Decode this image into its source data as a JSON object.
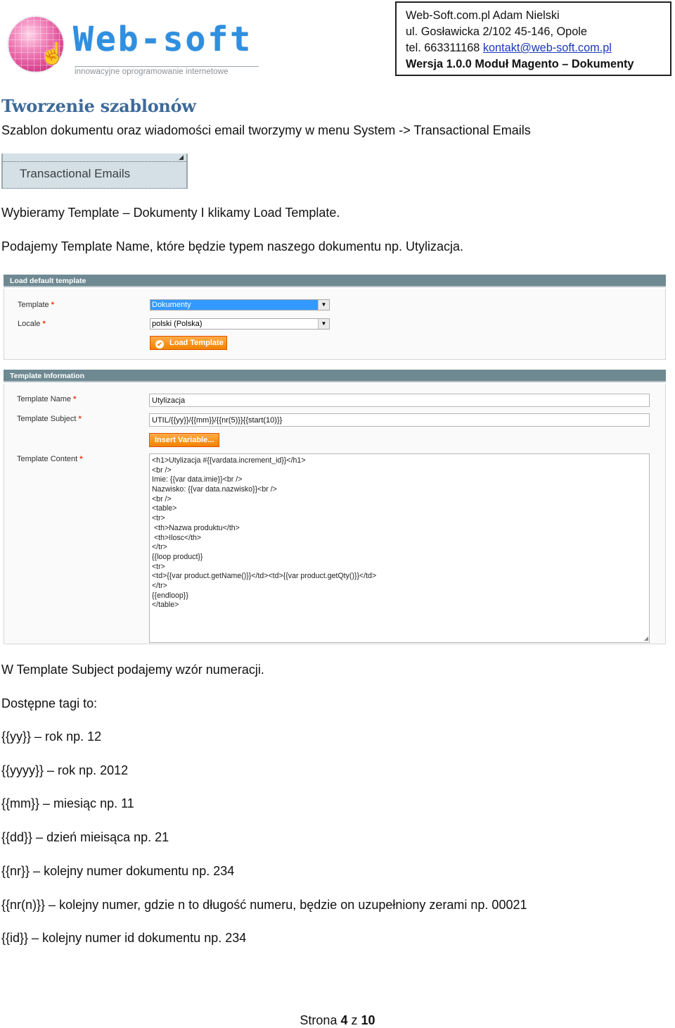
{
  "header": {
    "logo": {
      "wordmark": "Web-soft",
      "tagline": "innowacyjne oprogramowanie internetowe",
      "icon": "globe-with-hand-cursor-icon"
    },
    "contact": {
      "company": "Web-Soft.com.pl Adam Nielski",
      "address": "ul. Gosławicka 2/102 45-146, Opole",
      "phone_prefix": "tel. 663311168",
      "email": "kontakt@web-soft.com.pl",
      "version_line": "Wersja 1.0.0 Moduł Magento – Dokumenty"
    }
  },
  "section": {
    "title": "Tworzenie szablonów",
    "intro": "Szablon dokumentu oraz wiadomości email tworzymy w menu System -> Transactional Emails",
    "menu_item": "Transactional Emails",
    "step1": "Wybieramy Template – Dokumenty I klikamy Load Template.",
    "step2": "Podajemy Template Name, które będzie typem naszego dokumentu np. Utylizacja."
  },
  "load_default": {
    "title": "Load default template",
    "template_label": "Template",
    "template_value": "Dokumenty",
    "locale_label": "Locale",
    "locale_value": "polski (Polska)",
    "required_mark": "*",
    "load_button": "Load Template"
  },
  "template_info": {
    "title": "Template Information",
    "name_label": "Template Name",
    "name_value": "Utylizacja",
    "subject_label": "Template Subject",
    "subject_value": "UTIL/{{yy}}/{{mm}}/{{nr(5)}}{{start(10)}}",
    "insert_variable_button": "Insert Variable...",
    "content_label": "Template Content",
    "content_lines": [
      "<h1>Utylizacja #{{vardata.increment_id}}</h1>",
      "<br />",
      "Imie: {{var data.imie}}<br />",
      "Nazwisko: {{var data.nazwisko}}<br />",
      "<br />",
      "<table>",
      "<tr>",
      " <th>Nazwa produktu</th>",
      " <th>Ilosc</th>",
      "</tr>",
      "{{loop product}}",
      "<tr>",
      "<td>{{var product.getName()}}</td><td>{{var product.getQty()}}</td>",
      "</tr>",
      "{{endloop}}",
      "</table>"
    ]
  },
  "tags": {
    "intro": "W Template Subject podajemy wzór numeracji.",
    "heading": "Dostępne tagi to:",
    "items": [
      "{{yy}} – rok np. 12",
      "{{yyyy}} – rok np. 2012",
      "{{mm}} – miesiąc np. 11",
      "{{dd}} – dzień mieisąca np. 21",
      "{{nr}} – kolejny numer dokumentu np. 234",
      "{{nr(n)}} – kolejny numer, gdzie n to długość numeru, będzie on uzupełniony zerami np. 00021",
      "{{id}} – kolejny numer id dokumentu np. 234"
    ]
  },
  "footer": {
    "prefix": "Strona",
    "current_page": "4",
    "separator": "z",
    "total_pages": "10"
  },
  "colors": {
    "heading": "#3e6a98",
    "fieldset_header": "#6f8992",
    "button_orange": "#f18200",
    "select_highlight": "#3399ff",
    "link": "#1b39b8",
    "required": "#eb340a"
  }
}
